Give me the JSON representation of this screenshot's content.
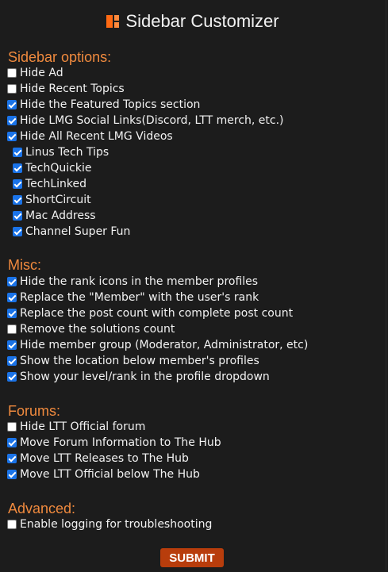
{
  "title": "Sidebar Customizer",
  "icons": {
    "logo": "ltt-logo-icon"
  },
  "colors": {
    "accent": "#f08a3e",
    "checkbox": "#1a73e8",
    "submit": "#b83d0c",
    "background": "#1c1c1c"
  },
  "sections": {
    "sidebar": {
      "title": "Sidebar options:",
      "items": [
        {
          "label": "Hide Ad",
          "checked": false
        },
        {
          "label": "Hide Recent Topics",
          "checked": false
        },
        {
          "label": "Hide the Featured Topics section",
          "checked": true
        },
        {
          "label": "Hide LMG Social Links(Discord, LTT merch, etc.)",
          "checked": true
        },
        {
          "label": "Hide All Recent LMG Videos",
          "checked": true
        },
        {
          "label": "Linus Tech Tips",
          "checked": true
        },
        {
          "label": "TechQuickie",
          "checked": true
        },
        {
          "label": "TechLinked",
          "checked": true
        },
        {
          "label": "ShortCircuit",
          "checked": true
        },
        {
          "label": "Mac Address",
          "checked": true
        },
        {
          "label": "Channel Super Fun",
          "checked": true
        }
      ]
    },
    "misc": {
      "title": "Misc:",
      "items": [
        {
          "label": "Hide the rank icons in the member profiles",
          "checked": true
        },
        {
          "label": "Replace the \"Member\" with the user's rank",
          "checked": true
        },
        {
          "label": "Replace the post count with complete post count",
          "checked": true
        },
        {
          "label": "Remove the solutions count",
          "checked": false
        },
        {
          "label": "Hide member group (Moderator, Administrator, etc)",
          "checked": true
        },
        {
          "label": "Show the location below member's profiles",
          "checked": true
        },
        {
          "label": "Show your level/rank in the profile dropdown",
          "checked": true
        }
      ]
    },
    "forums": {
      "title": "Forums:",
      "items": [
        {
          "label": "Hide LTT Official forum",
          "checked": false
        },
        {
          "label": "Move Forum Information to The Hub",
          "checked": true
        },
        {
          "label": "Move LTT Releases to The Hub",
          "checked": true
        },
        {
          "label": "Move LTT Official below The Hub",
          "checked": true
        }
      ]
    },
    "advanced": {
      "title": "Advanced:",
      "items": [
        {
          "label": "Enable logging for troubleshooting",
          "checked": false
        }
      ]
    }
  },
  "submit_label": "SUBMIT"
}
